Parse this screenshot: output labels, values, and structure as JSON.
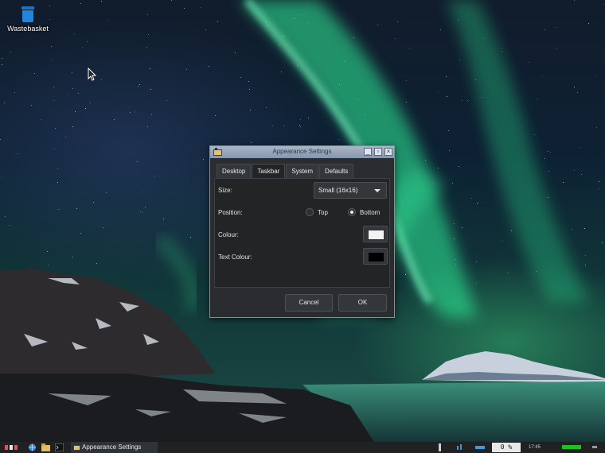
{
  "desktop": {
    "icons": [
      {
        "label": "Wastebasket",
        "icon": "trash-icon"
      }
    ]
  },
  "dialog": {
    "title": "Appearance Settings",
    "tabs": [
      {
        "label": "Desktop",
        "active": false
      },
      {
        "label": "Taskbar",
        "active": true
      },
      {
        "label": "System",
        "active": false
      },
      {
        "label": "Defaults",
        "active": false
      }
    ],
    "size": {
      "label": "Size:",
      "value": "Small (16x16)"
    },
    "position": {
      "label": "Position:",
      "options": [
        {
          "label": "Top",
          "checked": false
        },
        {
          "label": "Bottom",
          "checked": true
        }
      ]
    },
    "colour": {
      "label": "Colour:",
      "swatch": "#f2f2f2"
    },
    "text_colour": {
      "label": "Text Colour:",
      "swatch": "#000000"
    },
    "buttons": {
      "cancel": "Cancel",
      "ok": "OK"
    }
  },
  "taskbar": {
    "window_button": "Appearance Settings",
    "cpu": "0 %",
    "clock": "17:45",
    "launchers": [
      "globe-icon",
      "folder-icon",
      "terminal-icon"
    ],
    "accent": "#20c020"
  }
}
